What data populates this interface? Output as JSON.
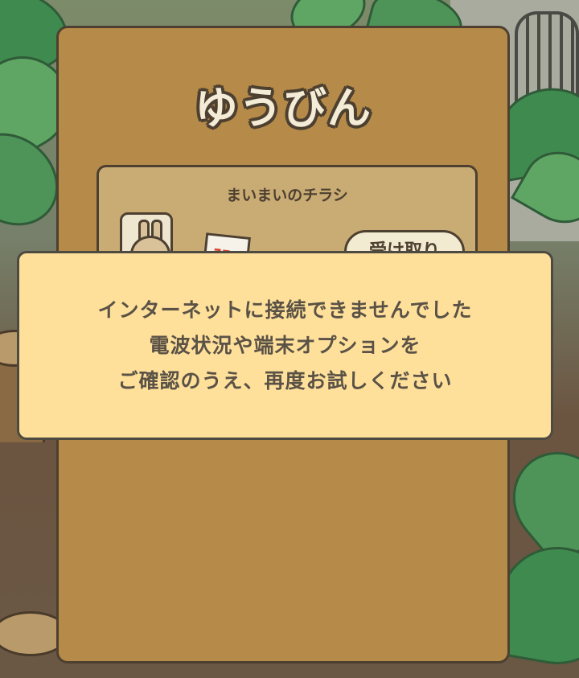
{
  "panel": {
    "title": "ゆうびん",
    "mail_item": {
      "title": "まいまいのチラシ",
      "flyer_mark": "ｽﾌ",
      "receive_button_label": "受け取り"
    }
  },
  "error_dialog": {
    "lines": [
      "インターネットに接続できませんでした",
      "電波状況や端末オプションを",
      "ご確認のうえ、再度お試しください"
    ]
  },
  "colors": {
    "panel": "#b68b4a",
    "mail_item": "#c9ab74",
    "dialog": "#ffe09b",
    "outline": "#4d4030",
    "dialog_text": "#5a5246"
  }
}
